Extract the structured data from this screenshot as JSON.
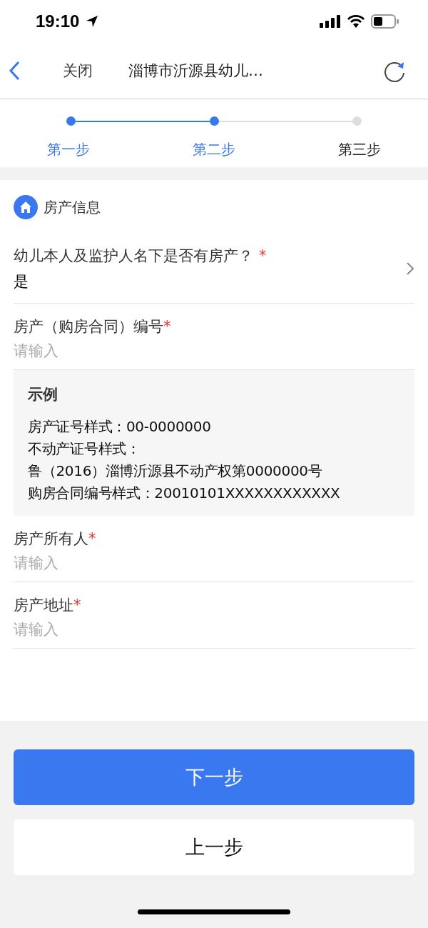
{
  "status_bar": {
    "time": "19:10"
  },
  "nav": {
    "close": "关闭",
    "title": "淄博市沂源县幼儿…"
  },
  "steps": [
    {
      "label": "第一步",
      "completed": true
    },
    {
      "label": "第二步",
      "completed": true
    },
    {
      "label": "第三步",
      "completed": false
    }
  ],
  "section": {
    "title": "房产信息"
  },
  "fields": [
    {
      "kind": "select",
      "label": "幼儿本人及监护人名下是否有房产？",
      "required_mark": "*",
      "value": "是"
    },
    {
      "kind": "input",
      "label": "房产（购房合同）编号",
      "required_mark": "*",
      "placeholder": "请输入"
    },
    {
      "kind": "example",
      "title": "示例",
      "lines": [
        "房产证号样式：00-0000000",
        "不动产证号样式：",
        "鲁（2016）淄博沂源县不动产权第0000000号",
        "购房合同编号样式：20010101XXXXXXXXXXXX"
      ]
    },
    {
      "kind": "input",
      "label": "房产所有人",
      "required_mark": "*",
      "placeholder": "请输入"
    },
    {
      "kind": "input",
      "label": "房产地址",
      "required_mark": "*",
      "placeholder": "请输入"
    }
  ],
  "buttons": [
    {
      "kind": "primary",
      "label": "下一步"
    },
    {
      "kind": "secondary",
      "label": "上一步"
    }
  ]
}
